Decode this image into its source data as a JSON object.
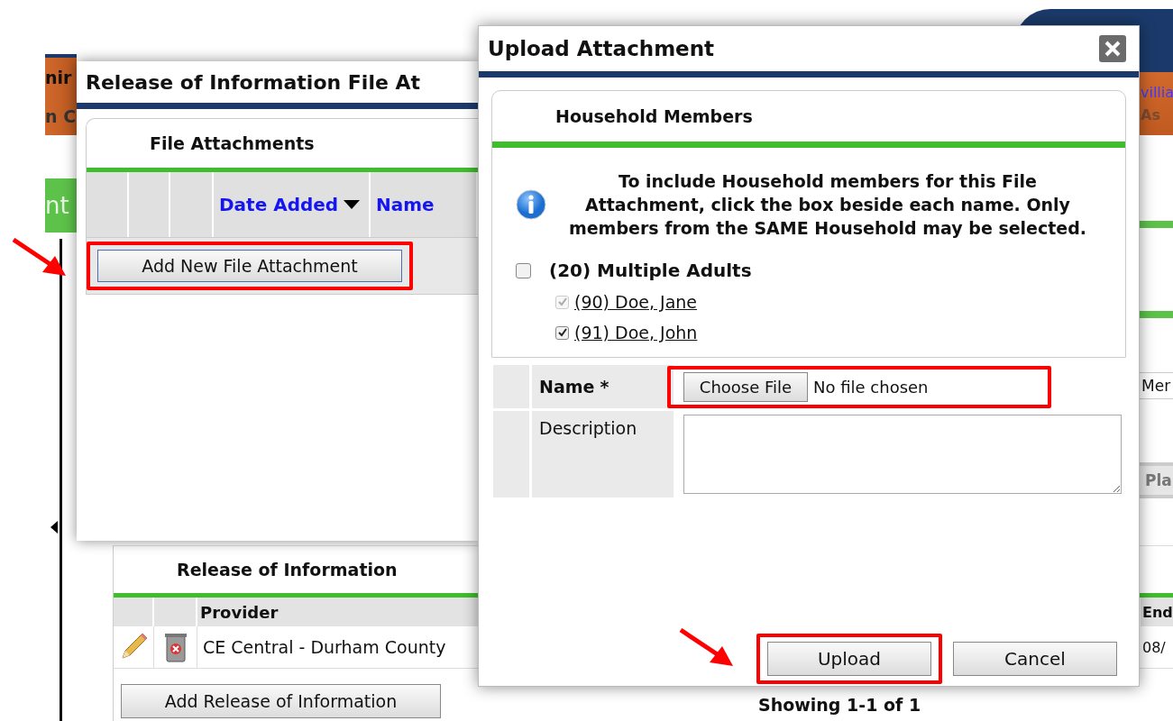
{
  "background": {
    "header_texts": [
      "nir",
      "n C"
    ],
    "tab_text": "nt",
    "user_link": "villia",
    "role_text": "As",
    "side_labels": [
      {
        "text": "Mer",
        "kind": "plain"
      },
      {
        "text": "Pla",
        "kind": "header"
      }
    ]
  },
  "release_panel": {
    "title": "Release of Information",
    "columns": [
      "Provider",
      "End"
    ],
    "rows": [
      {
        "provider": "CE Central - Durham County",
        "end": "08/"
      }
    ],
    "add_button": "Add Release of Information",
    "pagination": "Showing 1-1 of 1"
  },
  "attachments_window": {
    "title": "Release of Information File At",
    "panel_title": "File Attachments",
    "columns": [
      {
        "label": "Date Added",
        "sorted": true
      },
      {
        "label": "Name",
        "sorted": false
      }
    ],
    "add_button": {
      "label": "Add New File Attachment",
      "highlighted": true,
      "arrow": true
    }
  },
  "upload_dialog": {
    "title": "Upload Attachment",
    "section_title": "Household Members",
    "info_text": "To include Household members for this File Attachment, click the box beside each name. Only members from the SAME Household may be selected.",
    "household": {
      "label": "(20) Multiple Adults",
      "checked": false,
      "members": [
        {
          "name": "(90) Doe, Jane",
          "checked": true,
          "disabled": true
        },
        {
          "name": "(91) Doe, John",
          "checked": true,
          "disabled": false
        }
      ]
    },
    "fields": [
      {
        "kind": "file",
        "label": "Name",
        "required_mark": "*",
        "button": "Choose File",
        "value": "No file chosen",
        "highlighted": true
      },
      {
        "kind": "textarea",
        "label": "Description"
      }
    ],
    "buttons": [
      {
        "label": "Upload",
        "highlighted": true,
        "arrow": true
      },
      {
        "label": "Cancel",
        "highlighted": false,
        "arrow": false
      }
    ]
  }
}
